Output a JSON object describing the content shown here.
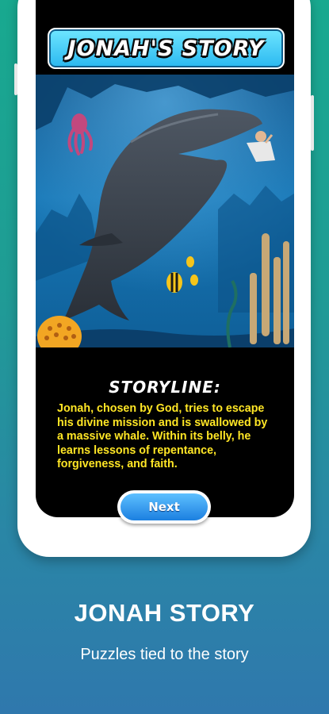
{
  "game": {
    "title": "JONAH'S STORY",
    "storyline_heading": "STORYLINE:",
    "storyline_text": "Jonah, chosen by God, tries to escape his divine mission and is swallowed by a massive whale. Within its belly, he learns lessons of repentance, forgiveness, and faith.",
    "next_label": "Next",
    "scene": {
      "image": "whale-swallowing-jonah-illustration",
      "elements": [
        "whale",
        "jonah",
        "octopus",
        "tropical-fish",
        "coral",
        "seaweed"
      ]
    }
  },
  "promo": {
    "title": "JONAH STORY",
    "subtitle": "Puzzles tied to the story"
  },
  "colors": {
    "background_top": "#18a98f",
    "background_bottom": "#2f78ad",
    "story_text": "#ffe625",
    "banner": "#2ab8f0",
    "button": "#1b7fe0"
  }
}
